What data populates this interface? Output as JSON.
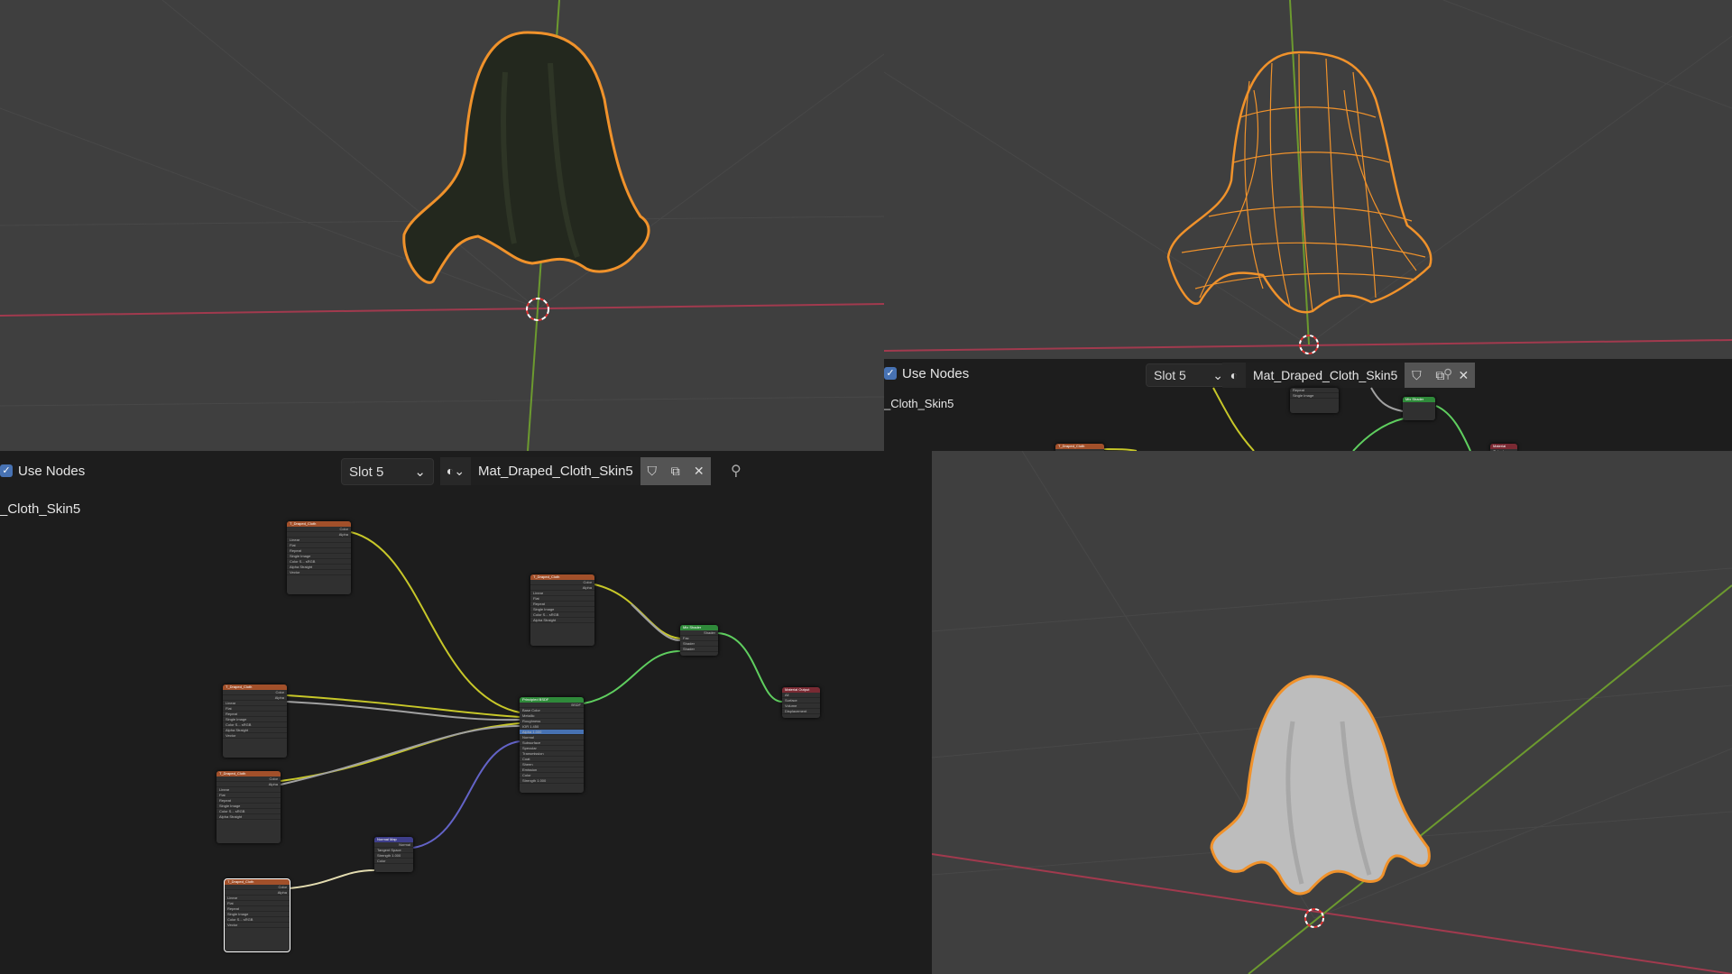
{
  "node_header": {
    "use_nodes_label": "Use Nodes",
    "use_nodes_checked": true,
    "slot": "Slot 5",
    "material_name": "Mat_Draped_Cloth_Skin5",
    "material_path_label": "_Cloth_Skin5"
  },
  "colors": {
    "selection_outline": "#f0922b",
    "x_axis": "#a13a4e",
    "y_axis": "#6c9a2f",
    "viewport_bg": "#3f3f3f",
    "editor_bg": "#1d1d1d",
    "link_color": "#c7c729",
    "link_shader": "#5fce5f",
    "link_vector": "#6363c7",
    "link_gray": "#a1a1a1"
  },
  "icons": {
    "material": "material-sphere-icon",
    "fake_user": "shield-icon",
    "duplicate": "copy-icon",
    "unlink": "close-icon",
    "pin": "pin-icon",
    "dropdown": "chevron-down-icon"
  },
  "nodes": {
    "image_texture": {
      "title": "T_Draped_Cloth",
      "outputs": [
        "Color",
        "Alpha"
      ],
      "rows": [
        "Linear",
        "Flat",
        "Repeat",
        "Single Image",
        "Color S...  sRGB",
        "Alpha  Straight",
        "Vector"
      ]
    },
    "principled": {
      "title": "Principled BSDF",
      "output": "BSDF",
      "rows": [
        "Base Color",
        "Metallic",
        "Roughness",
        "IOR  1.450",
        "Alpha  1.000",
        "Normal",
        "Subsurface",
        "Specular",
        "Transmission",
        "Coat",
        "Sheen",
        "Emission",
        "Color",
        "Strength  1.000"
      ]
    },
    "mix": {
      "title": "Mix Shader",
      "output": "Shader",
      "rows": [
        "Fac",
        "Shader",
        "Shader"
      ]
    },
    "output": {
      "title": "Material Output",
      "rows": [
        "All",
        "Surface",
        "Volume",
        "Displacement"
      ]
    },
    "normal_map": {
      "title": "Normal Map",
      "output": "Normal",
      "rows": [
        "Tangent Space",
        "Strength 1.000",
        "Color"
      ]
    }
  }
}
